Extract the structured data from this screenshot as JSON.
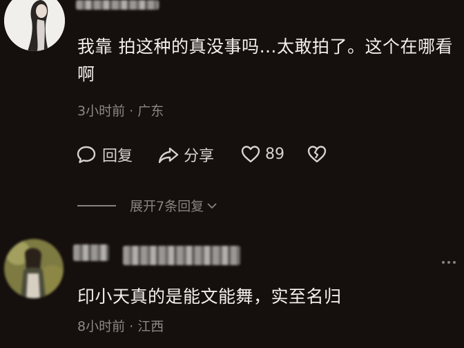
{
  "comments": [
    {
      "text": "我靠 拍这种的真没事吗…太敢拍了。这个在哪看啊",
      "time": "3小时前",
      "location": "广东",
      "actions": {
        "reply": "回复",
        "share": "分享",
        "likes": "89"
      },
      "expand_label": "展开7条回复"
    },
    {
      "text": "印小天真的是能文能舞，实至名归",
      "time": "8小时前",
      "location": "江西"
    }
  ],
  "icons": [
    "reply-icon",
    "share-icon",
    "heart-icon",
    "broken-heart-icon",
    "chevron-down-icon",
    "more-icon"
  ],
  "colors": {
    "background": "#150f0d",
    "text": "#f3efeb",
    "meta": "#8f8985"
  }
}
